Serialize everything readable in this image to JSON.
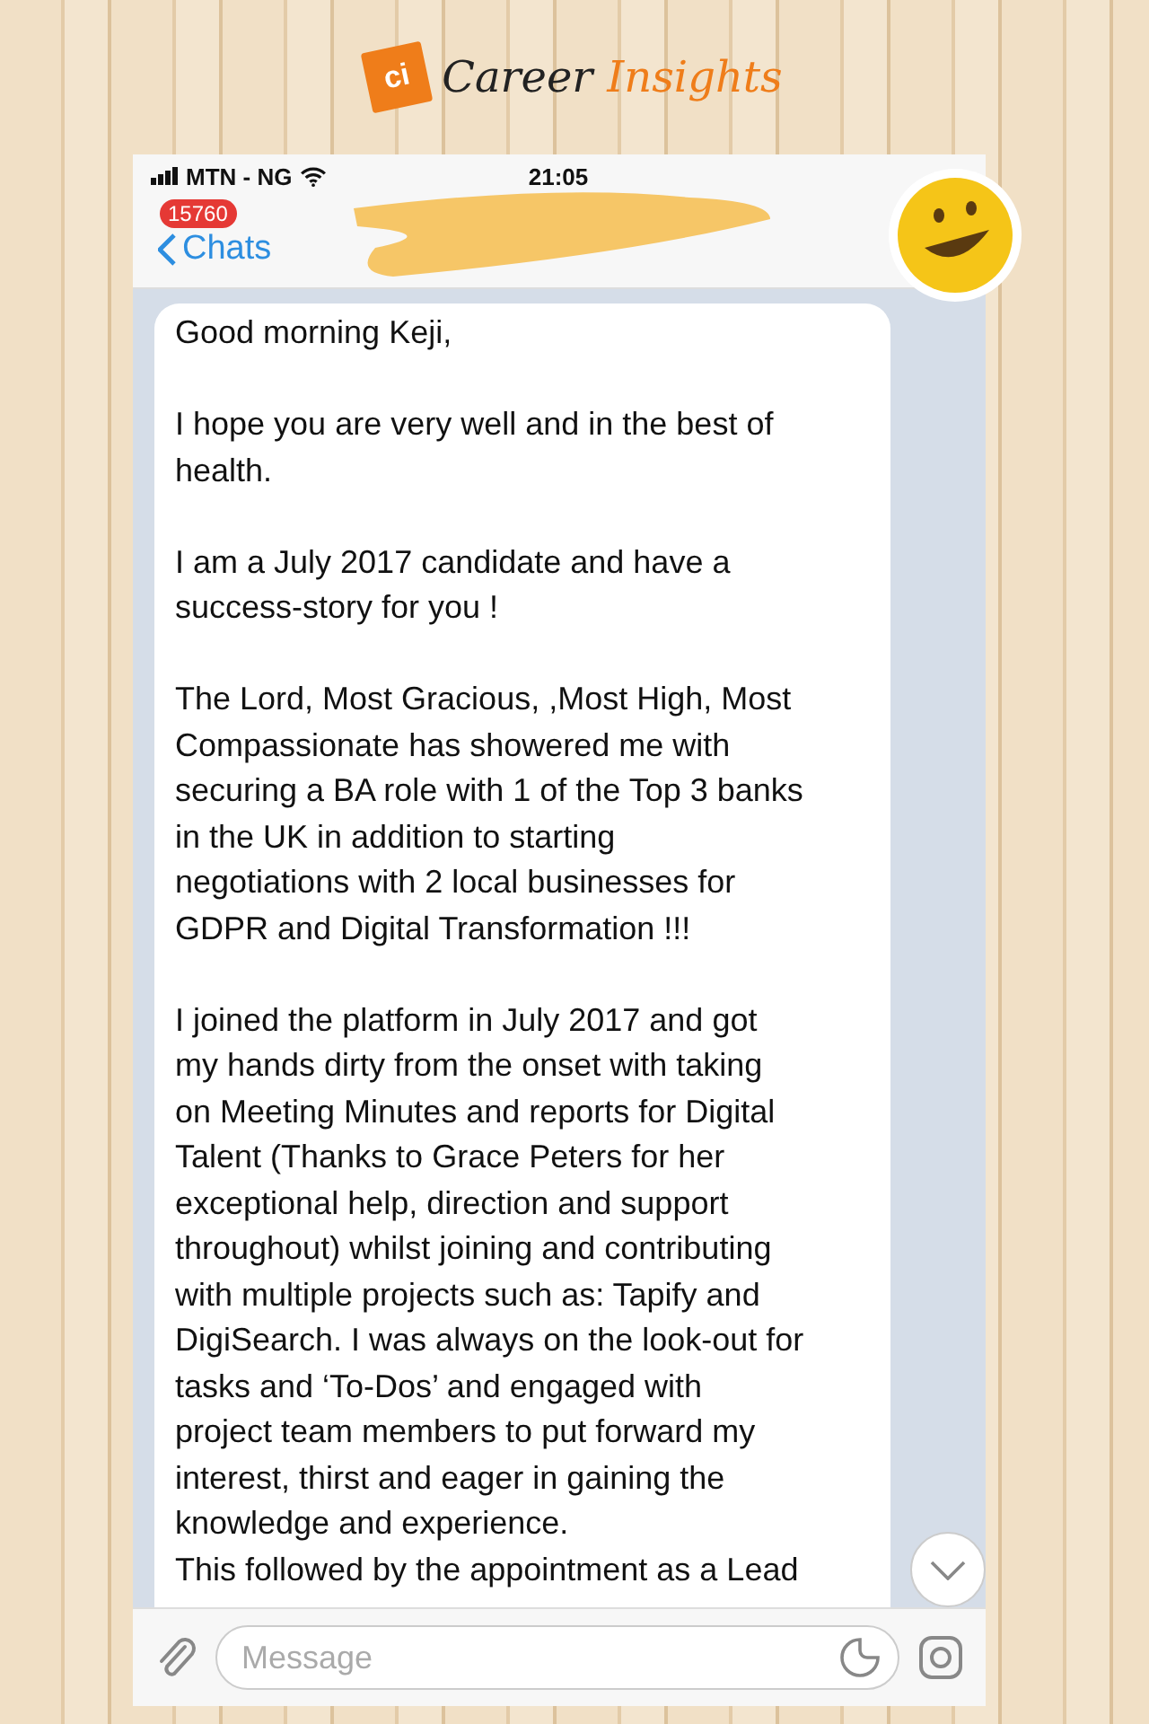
{
  "logo": {
    "mark": "ci",
    "word_1": "Career",
    "word_2": "Insights"
  },
  "status_bar": {
    "carrier": "MTN - NG",
    "time": "21:05"
  },
  "nav": {
    "back_label": "Chats",
    "badge": "15760"
  },
  "message": {
    "paragraphs": [
      [
        "Good morning Keji,"
      ],
      [
        "I hope you are very well and in the best of",
        "health."
      ],
      [
        "I am a July 2017 candidate and have a",
        "success-story for you !"
      ],
      [
        "The Lord, Most Gracious, ,Most High, Most",
        "Compassionate has showered me with",
        "securing a BA role with 1 of the Top 3 banks",
        "in the UK in addition to starting",
        "negotiations with 2 local businesses for",
        "GDPR and Digital Transformation !!!"
      ],
      [
        "I joined the platform in July 2017 and got",
        "my hands dirty from the onset with taking",
        "on Meeting Minutes and reports for Digital",
        "Talent (Thanks to Grace Peters for her",
        "exceptional help, direction and support",
        "throughout) whilst joining and contributing",
        "with multiple projects such as: Tapify and",
        "DigiSearch. I was always on the look-out for",
        "tasks and ‘To-Dos’ and engaged with",
        "project team members to put forward my",
        "interest, thirst and eager in gaining the",
        "knowledge and experience.",
        "This followed by the appointment as a Lead"
      ]
    ]
  },
  "composer": {
    "placeholder": "Message"
  }
}
